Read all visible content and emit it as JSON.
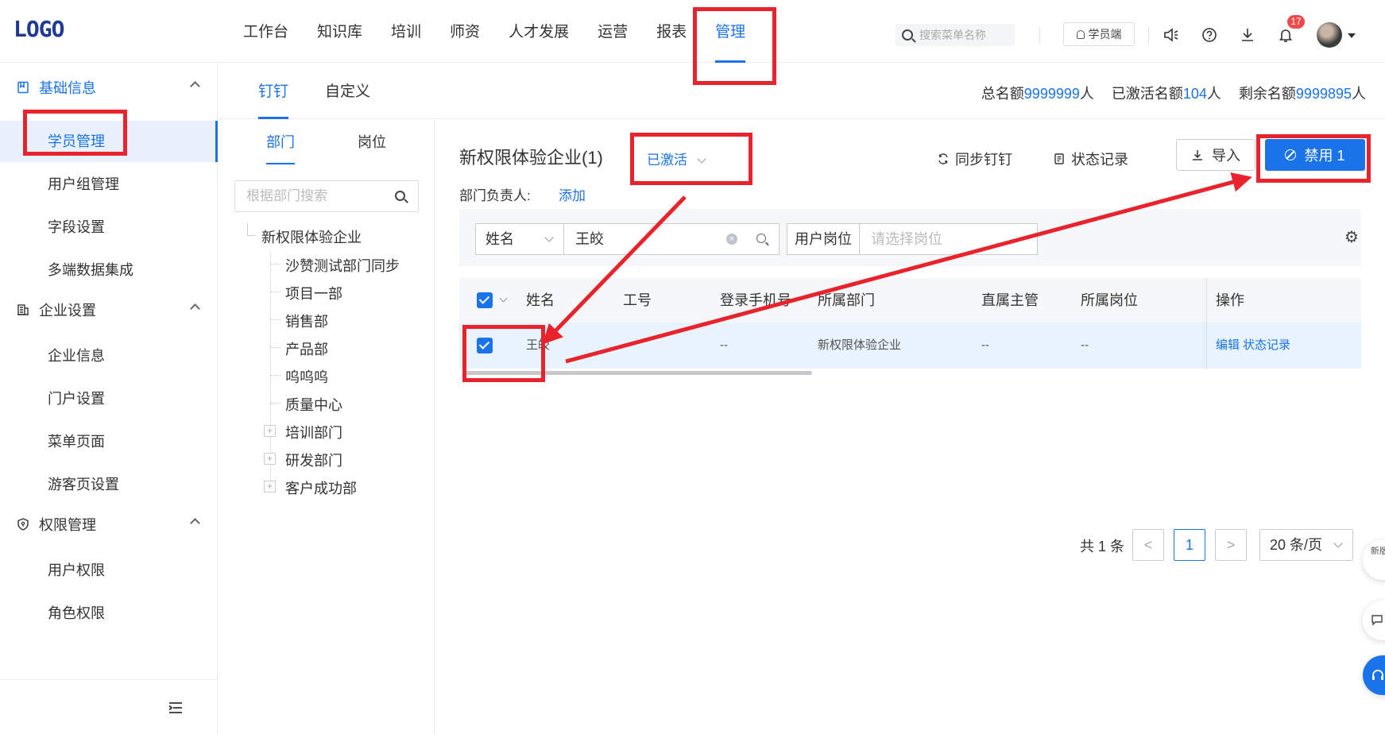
{
  "header": {
    "logo": "LOGO",
    "nav": [
      "工作台",
      "知识库",
      "培训",
      "师资",
      "人才发展",
      "运营",
      "报表",
      "管理"
    ],
    "active_nav": "管理",
    "search_placeholder": "搜索菜单名称",
    "student_btn": "学员端",
    "notification_count": "17",
    "icons": [
      "speaker-icon",
      "help-icon",
      "download-icon",
      "bell-icon"
    ]
  },
  "sidebar": {
    "groups": [
      {
        "label": "基础信息",
        "icon": "book-icon",
        "items": [
          "学员管理",
          "用户组管理",
          "字段设置",
          "多端数据集成"
        ]
      },
      {
        "label": "企业设置",
        "icon": "building-icon",
        "items": [
          "企业信息",
          "门户设置",
          "菜单页面",
          "游客页设置"
        ]
      },
      {
        "label": "权限管理",
        "icon": "shield-icon",
        "items": [
          "用户权限",
          "角色权限"
        ]
      }
    ],
    "active_item": "学员管理"
  },
  "content_tabs": {
    "tab1": "钉钉",
    "tab2": "自定义"
  },
  "quota": {
    "total_label": "总名额",
    "total_value": "9999999",
    "total_unit": "人",
    "activated_label": "已激活名额",
    "activated_value": "104",
    "activated_unit": "人",
    "remaining_label": "剩余名额",
    "remaining_value": "9999895",
    "remaining_unit": "人"
  },
  "dept_panel": {
    "tab_dept": "部门",
    "tab_post": "岗位",
    "search_placeholder": "根据部门搜索",
    "root": "新权限体验企业",
    "children": [
      "沙赞测试部门同步",
      "项目一部",
      "销售部",
      "产品部",
      "呜呜呜",
      "质量中心"
    ],
    "collapsed": [
      "培训部门",
      "研发部门",
      "客户成功部"
    ]
  },
  "main": {
    "title": "新权限体验企业(1)",
    "status": "已激活",
    "head_label": "部门负责人:",
    "head_add": "添加",
    "sync_label": "同步钉钉",
    "record_label": "状态记录",
    "import_label": "导入",
    "disable_label": "禁用 1",
    "filter": {
      "field": "姓名",
      "value": "王皎",
      "post_label": "用户岗位",
      "post_placeholder": "请选择岗位"
    },
    "table": {
      "headers": [
        "姓名",
        "工号",
        "登录手机号",
        "所属部门",
        "直属主管",
        "所属岗位",
        "操作"
      ],
      "rows": [
        {
          "name": "王皎",
          "no": "--",
          "phone": "--",
          "dept": "新权限体验企业",
          "manager": "--",
          "post": "--",
          "edit": "编辑",
          "record": "状态记录"
        }
      ]
    }
  },
  "pager": {
    "total_text": "共 1 条",
    "prev": "<",
    "current": "1",
    "next": ">",
    "page_size": "20 条/页"
  },
  "floating": {
    "top_text": "新版引导"
  },
  "colors": {
    "accent": "#1a73e8",
    "annotation": "#e8232b"
  }
}
